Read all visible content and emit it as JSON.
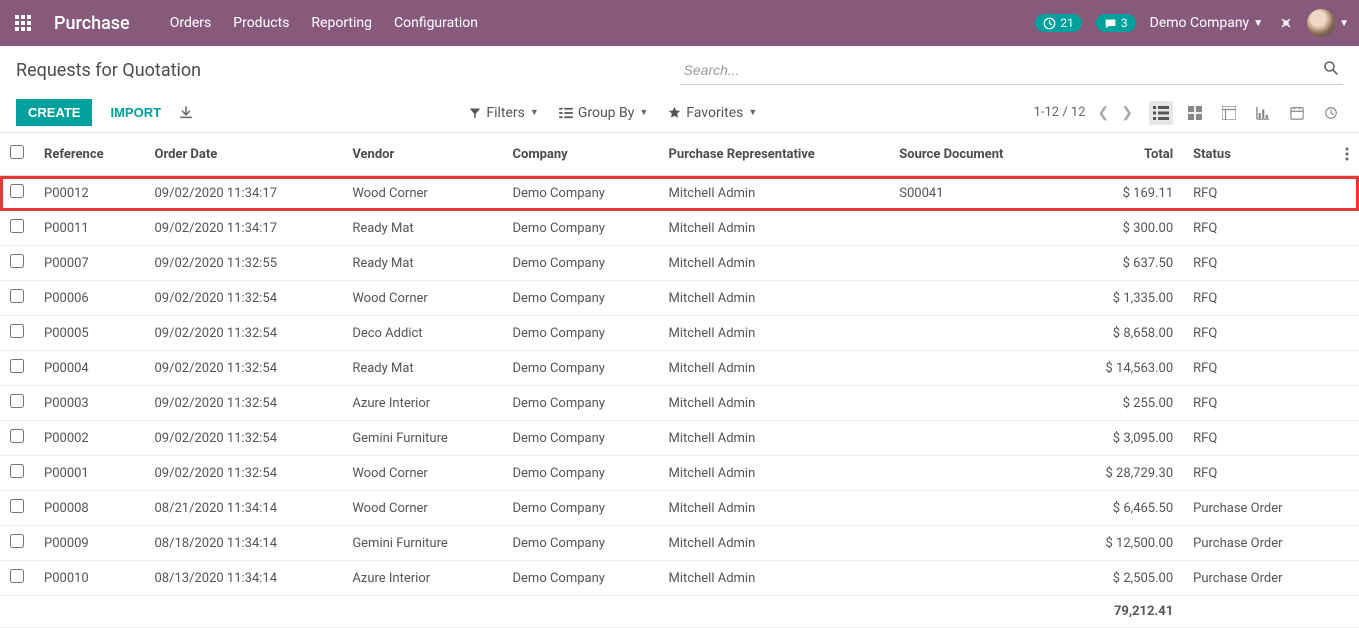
{
  "navbar": {
    "app_name": "Purchase",
    "menu": [
      "Orders",
      "Products",
      "Reporting",
      "Configuration"
    ],
    "clock_count": "21",
    "chat_count": "3",
    "company": "Demo Company"
  },
  "control": {
    "title": "Requests for Quotation",
    "search_placeholder": "Search...",
    "create": "CREATE",
    "import": "IMPORT",
    "filters": "Filters",
    "groupby": "Group By",
    "favorites": "Favorites",
    "pager": "1-12 / 12"
  },
  "columns": {
    "ref": "Reference",
    "date": "Order Date",
    "vendor": "Vendor",
    "company": "Company",
    "rep": "Purchase Representative",
    "source": "Source Document",
    "total": "Total",
    "status": "Status"
  },
  "rows": [
    {
      "ref": "P00012",
      "date": "09/02/2020 11:34:17",
      "vendor": "Wood Corner",
      "company": "Demo Company",
      "rep": "Mitchell Admin",
      "source": "S00041",
      "total": "$ 169.11",
      "status": "RFQ",
      "highlight": true
    },
    {
      "ref": "P00011",
      "date": "09/02/2020 11:34:17",
      "vendor": "Ready Mat",
      "company": "Demo Company",
      "rep": "Mitchell Admin",
      "source": "",
      "total": "$ 300.00",
      "status": "RFQ"
    },
    {
      "ref": "P00007",
      "date": "09/02/2020 11:32:55",
      "vendor": "Ready Mat",
      "company": "Demo Company",
      "rep": "Mitchell Admin",
      "source": "",
      "total": "$ 637.50",
      "status": "RFQ"
    },
    {
      "ref": "P00006",
      "date": "09/02/2020 11:32:54",
      "vendor": "Wood Corner",
      "company": "Demo Company",
      "rep": "Mitchell Admin",
      "source": "",
      "total": "$ 1,335.00",
      "status": "RFQ"
    },
    {
      "ref": "P00005",
      "date": "09/02/2020 11:32:54",
      "vendor": "Deco Addict",
      "company": "Demo Company",
      "rep": "Mitchell Admin",
      "source": "",
      "total": "$ 8,658.00",
      "status": "RFQ"
    },
    {
      "ref": "P00004",
      "date": "09/02/2020 11:32:54",
      "vendor": "Ready Mat",
      "company": "Demo Company",
      "rep": "Mitchell Admin",
      "source": "",
      "total": "$ 14,563.00",
      "status": "RFQ"
    },
    {
      "ref": "P00003",
      "date": "09/02/2020 11:32:54",
      "vendor": "Azure Interior",
      "company": "Demo Company",
      "rep": "Mitchell Admin",
      "source": "",
      "total": "$ 255.00",
      "status": "RFQ"
    },
    {
      "ref": "P00002",
      "date": "09/02/2020 11:32:54",
      "vendor": "Gemini Furniture",
      "company": "Demo Company",
      "rep": "Mitchell Admin",
      "source": "",
      "total": "$ 3,095.00",
      "status": "RFQ"
    },
    {
      "ref": "P00001",
      "date": "09/02/2020 11:32:54",
      "vendor": "Wood Corner",
      "company": "Demo Company",
      "rep": "Mitchell Admin",
      "source": "",
      "total": "$ 28,729.30",
      "status": "RFQ"
    },
    {
      "ref": "P00008",
      "date": "08/21/2020 11:34:14",
      "vendor": "Wood Corner",
      "company": "Demo Company",
      "rep": "Mitchell Admin",
      "source": "",
      "total": "$ 6,465.50",
      "status": "Purchase Order"
    },
    {
      "ref": "P00009",
      "date": "08/18/2020 11:34:14",
      "vendor": "Gemini Furniture",
      "company": "Demo Company",
      "rep": "Mitchell Admin",
      "source": "",
      "total": "$ 12,500.00",
      "status": "Purchase Order"
    },
    {
      "ref": "P00010",
      "date": "08/13/2020 11:34:14",
      "vendor": "Azure Interior",
      "company": "Demo Company",
      "rep": "Mitchell Admin",
      "source": "",
      "total": "$ 2,505.00",
      "status": "Purchase Order"
    }
  ],
  "footer_total": "79,212.41"
}
